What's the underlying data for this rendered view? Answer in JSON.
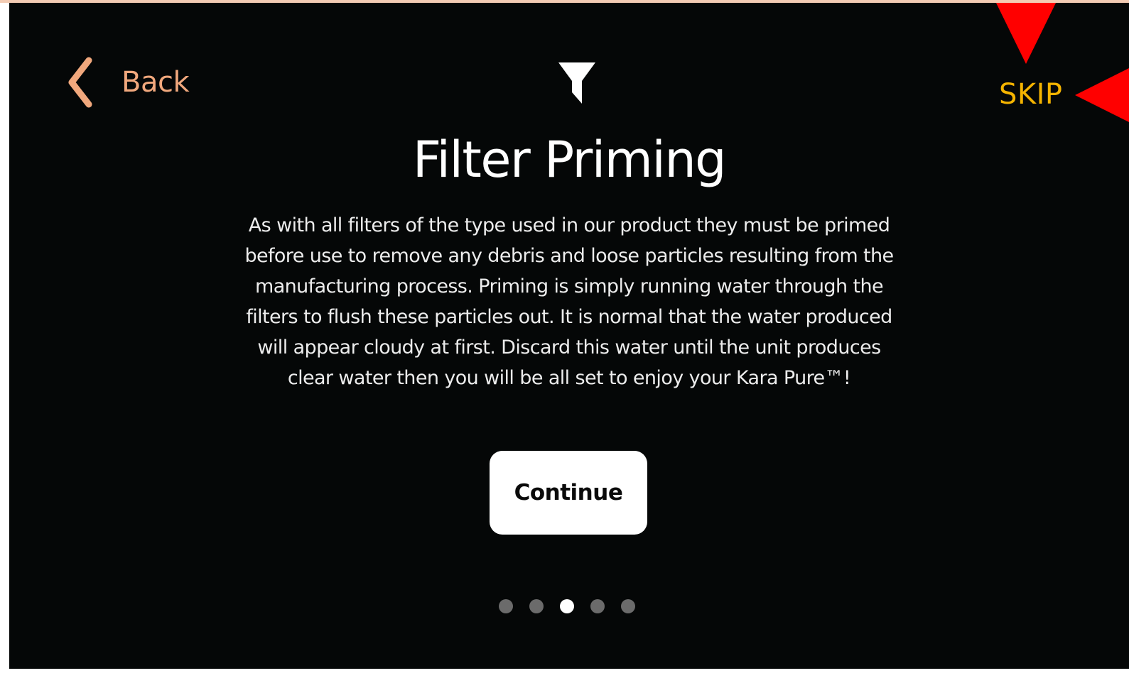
{
  "header": {
    "back_label": "Back",
    "skip_label": "SKIP"
  },
  "main": {
    "icon": "filter-funnel-icon",
    "title": "Filter Priming",
    "description": "As with all filters of the type used in our product they must be primed before use to remove any debris and loose particles resulting from the manufacturing process. Priming is simply running water through the filters to flush these particles out. It is normal that the water produced will appear cloudy at first. Discard this water until the unit produces clear water then you will be all set to enjoy your Kara Pure™!",
    "continue_label": "Continue"
  },
  "pager": {
    "total": 5,
    "active_index": 2
  },
  "annotations": {
    "arrows": [
      "down-arrow-icon",
      "left-arrow-icon"
    ],
    "color": "#ff0000"
  },
  "colors": {
    "background": "#050707",
    "back_accent": "#f1a87d",
    "skip_accent": "#f5b400",
    "title": "#ffffff",
    "body_text": "#ececec",
    "dot_inactive": "#6b6b6b",
    "dot_active": "#ffffff"
  }
}
